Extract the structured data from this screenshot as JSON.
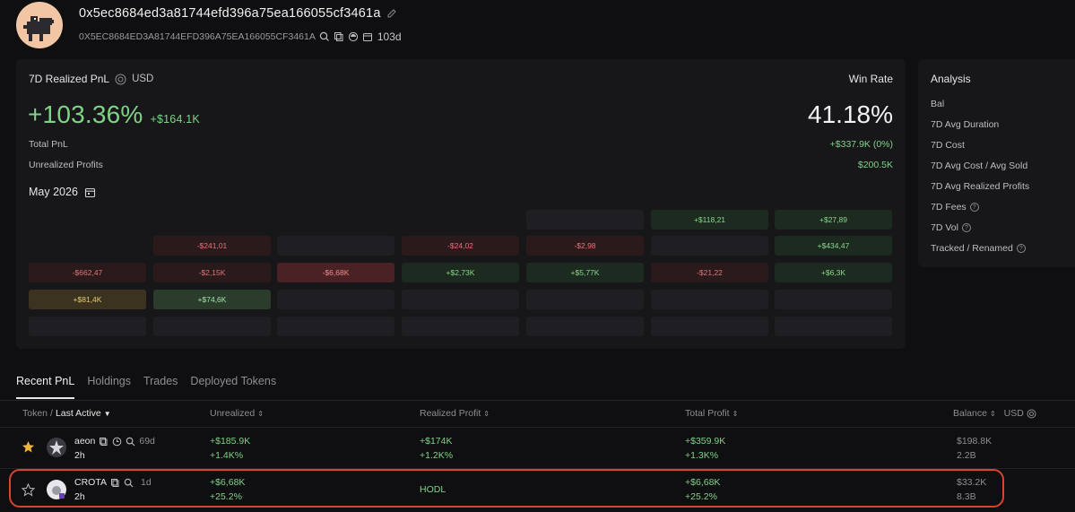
{
  "header": {
    "address": "0x5ec8684ed3a81744efd396a75ea166055cf3461a",
    "address_upper": "0X5EC8684ED3A81744EFD396A75EA166055CF3461A",
    "age": "103d"
  },
  "pnl": {
    "label": "7D Realized PnL",
    "currency": "USD",
    "percent": "+103.36%",
    "amount": "+$164.1K",
    "total_label": "Total PnL",
    "total_value": "+$337.9K (0%)",
    "unrealized_label": "Unrealized Profits",
    "unrealized_value": "$200.5K",
    "winrate_label": "Win Rate",
    "winrate_value": "41.18%",
    "month": "May 2026"
  },
  "calendar": {
    "row1": [
      "+$118,21",
      "+$27,89"
    ],
    "row2": [
      "-$241,01",
      "-$24,02",
      "-$2,98",
      "+$434,47"
    ],
    "row3": [
      "-$662,47",
      "-$2,15K",
      "-$6,68K",
      "+$2,73K",
      "+$5,77K",
      "-$21,22",
      "+$6,3K"
    ],
    "row4": [
      "+$81,4K",
      "+$74,6K"
    ]
  },
  "analysis": {
    "title": "Analysis",
    "items": [
      "Bal",
      "7D Avg Duration",
      "7D Cost",
      "7D Avg Cost / Avg Sold",
      "7D Avg Realized Profits",
      "7D Fees",
      "7D Vol",
      "Tracked / Renamed"
    ]
  },
  "tabs": [
    "Recent PnL",
    "Holdings",
    "Trades",
    "Deployed Tokens"
  ],
  "table": {
    "headers": {
      "token": "Token",
      "sep": "/",
      "last_active": "Last Active",
      "unrealized": "Unrealized",
      "realized": "Realized Profit",
      "total": "Total Profit",
      "balance": "Balance",
      "usd": "USD"
    },
    "rows": [
      {
        "name": "aeon",
        "age": "69d",
        "time": "2h",
        "unrealized": "+$185.9K",
        "unrealized_pct": "+1.4K%",
        "realized": "+$174K",
        "realized_pct": "+1.2K%",
        "total": "+$359.9K",
        "total_pct": "+1.3K%",
        "balance": "$198.8K",
        "balance_amt": "2.2B"
      },
      {
        "name": "CROTA",
        "age": "1d",
        "time": "2h",
        "unrealized": "+$6,68K",
        "unrealized_pct": "+25.2%",
        "realized": "HODL",
        "total": "+$6,68K",
        "total_pct": "+25.2%",
        "balance": "$33.2K",
        "balance_amt": "8.3B"
      }
    ]
  },
  "colors": {
    "positive": "#7fd387",
    "negative": "#e57378",
    "highlight": "#d9442c"
  }
}
